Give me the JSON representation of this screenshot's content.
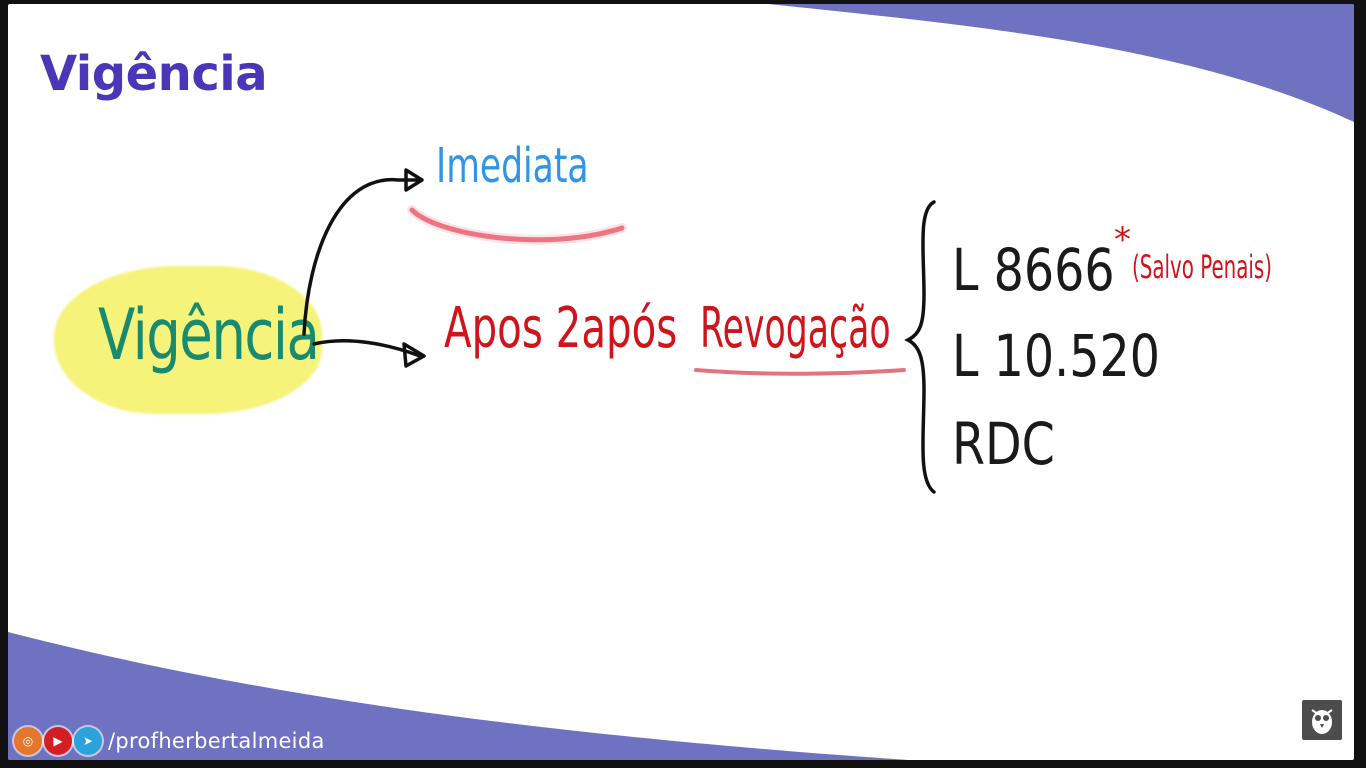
{
  "slide": {
    "title": "Vigência",
    "center_label": "Vigência",
    "branch_top": "Imediata",
    "branch_bottom_prefix": "Apos 2após",
    "branch_bottom_key": "Revogação",
    "laws": [
      "L 8666",
      "L 10.520",
      "RDC"
    ],
    "law_note_mark": "*",
    "law_note": "(Salvo Penais)"
  },
  "footer": {
    "icons": [
      "instagram-icon",
      "youtube-icon",
      "telegram-icon"
    ],
    "handle": "/profherbertalmeida",
    "logo": "owl-logo-icon"
  },
  "colors": {
    "title": "#4a37b8",
    "wave": "#6e72c0",
    "highlight": "#f6f37a",
    "center_label": "#178a6f",
    "branch_top": "#2e95e8",
    "branch_bottom": "#d0141c",
    "laws": "#1a1a1a"
  }
}
